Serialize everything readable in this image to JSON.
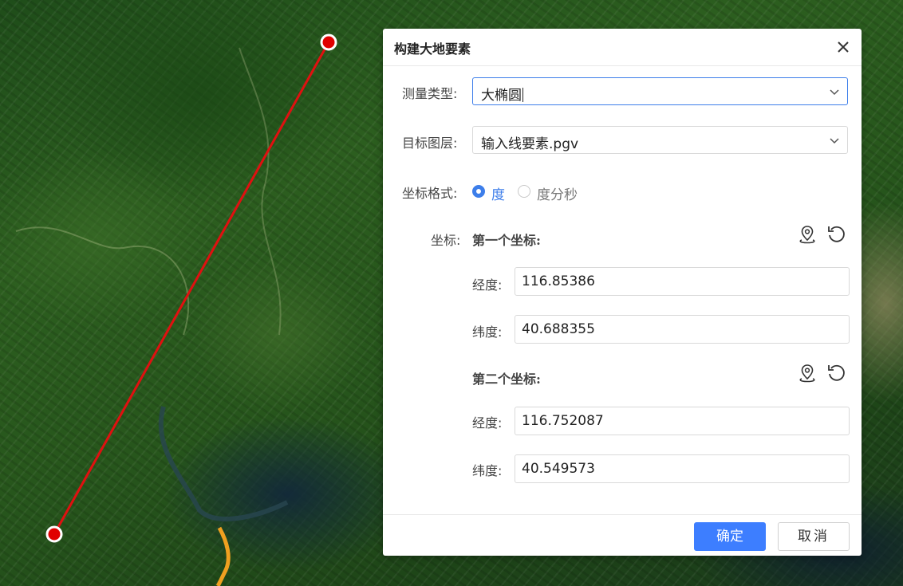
{
  "dialog": {
    "title": "构建大地要素",
    "measure_type_label": "测量类型:",
    "measure_type_value": "大椭圆",
    "target_layer_label": "目标图层:",
    "target_layer_value": "输入线要素.pgv",
    "coord_format_label": "坐标格式:",
    "coord_format_options": [
      "度",
      "度分秒"
    ],
    "coord_format_selected": "度",
    "coords_label": "坐标:",
    "first": {
      "title": "第一个坐标:",
      "lon_label": "经度:",
      "lon_value": "116.85386",
      "lat_label": "纬度:",
      "lat_value": "40.688355"
    },
    "second": {
      "title": "第二个坐标:",
      "lon_label": "经度:",
      "lon_value": "116.752087",
      "lat_label": "纬度:",
      "lat_value": "40.549573"
    },
    "ok_label": "确定",
    "cancel_label": "取消"
  },
  "colors": {
    "accent": "#3d7eff",
    "measure_line": "#e01010",
    "road": "#f0a020"
  },
  "icons": [
    "close-icon",
    "chevron-down-icon",
    "map-pin-icon",
    "reset-icon"
  ]
}
